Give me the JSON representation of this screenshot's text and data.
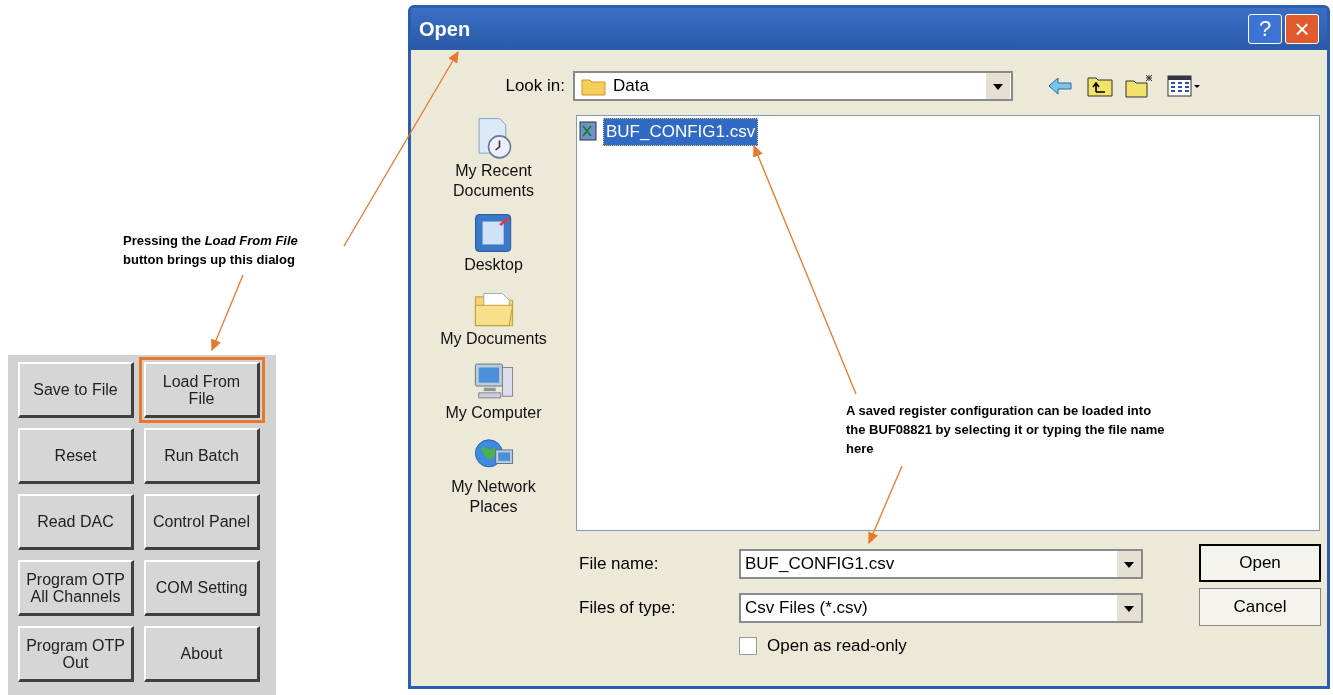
{
  "button_panel": {
    "buttons": [
      {
        "label": "Save to File",
        "highlighted": false
      },
      {
        "label": "Load From File",
        "highlighted": true
      },
      {
        "label": "Reset",
        "highlighted": false
      },
      {
        "label": "Run Batch",
        "highlighted": false
      },
      {
        "label": "Read DAC",
        "highlighted": false
      },
      {
        "label": "Control Panel",
        "highlighted": false
      },
      {
        "label": "Program OTP All Channels",
        "highlighted": false
      },
      {
        "label": "COM Setting",
        "highlighted": false
      },
      {
        "label": "Program OTP Out",
        "highlighted": false
      },
      {
        "label": "About",
        "highlighted": false
      }
    ]
  },
  "dialog": {
    "title": "Open",
    "help_button": "?",
    "close_button": "×",
    "look_in": {
      "label": "Look in:",
      "value": "Data"
    },
    "places": [
      "My Recent Documents",
      "Desktop",
      "My Documents",
      "My Computer",
      "My Network Places"
    ],
    "files": [
      {
        "name": "BUF_CONFIG1.csv",
        "selected": true
      }
    ],
    "file_name": {
      "label": "File name:",
      "value": "BUF_CONFIG1.csv"
    },
    "file_type": {
      "label": "Files of type:",
      "value": "Csv Files (*.csv)"
    },
    "read_only": {
      "label": "Open as read-only",
      "checked": false
    },
    "buttons": [
      "Open",
      "Cancel"
    ]
  },
  "annotations": [
    "Pressing the *Load From File* button brings up this dialog",
    "A saved register configuration can be loaded into the BUF08821 by selecting it or typing the file name here"
  ]
}
